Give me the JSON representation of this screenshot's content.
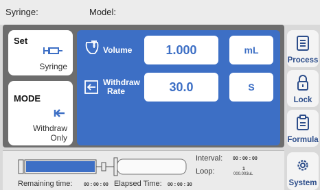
{
  "header": {
    "syringe_label": "Syringe:",
    "model_label": "Model:"
  },
  "set_card": {
    "title": "Set",
    "subtitle": "Syringe",
    "icon": "syringe-icon"
  },
  "mode_card": {
    "title": "MODE",
    "subtitle_line1": "Withdraw",
    "subtitle_line2": "Only",
    "icon": "withdraw-arrow-icon"
  },
  "params": {
    "volume": {
      "label": "Volume",
      "value": "1.000",
      "unit": "mL",
      "icon": "beaker-icon"
    },
    "withdraw_rate": {
      "label_line1": "Withdraw",
      "label_line2": "Rate",
      "value": "30.0",
      "unit": "S",
      "icon": "withdraw-rate-icon"
    }
  },
  "sidebar": {
    "process": "Process",
    "lock": "Lock",
    "formula": "Formula",
    "system": "System"
  },
  "status": {
    "interval_label": "Interval:",
    "interval_value": "00 : 00 : 00",
    "loop_label": "Loop:",
    "loop_value": "1",
    "loop_volume": "000.003uL",
    "remaining_label": "Remaining time:",
    "remaining_value": "00 : 00 : 00",
    "elapsed_label": "Elapsed Time:",
    "elapsed_value": "00 : 00 : 30",
    "progress_fraction": 0.0
  },
  "colors": {
    "accent_blue": "#3d6fc5",
    "frame_gray": "#6d6d6d"
  }
}
